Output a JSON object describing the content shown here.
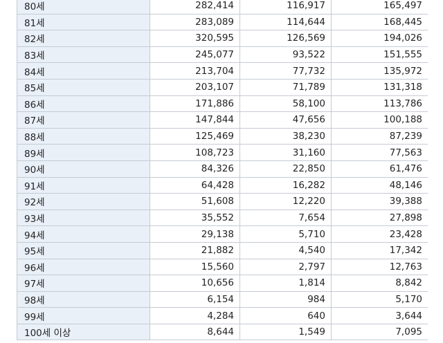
{
  "table": {
    "rows": [
      {
        "age": "80세",
        "total": "282,414",
        "male": "116,917",
        "female": "165,497"
      },
      {
        "age": "81세",
        "total": "283,089",
        "male": "114,644",
        "female": "168,445"
      },
      {
        "age": "82세",
        "total": "320,595",
        "male": "126,569",
        "female": "194,026"
      },
      {
        "age": "83세",
        "total": "245,077",
        "male": "93,522",
        "female": "151,555"
      },
      {
        "age": "84세",
        "total": "213,704",
        "male": "77,732",
        "female": "135,972"
      },
      {
        "age": "85세",
        "total": "203,107",
        "male": "71,789",
        "female": "131,318"
      },
      {
        "age": "86세",
        "total": "171,886",
        "male": "58,100",
        "female": "113,786"
      },
      {
        "age": "87세",
        "total": "147,844",
        "male": "47,656",
        "female": "100,188"
      },
      {
        "age": "88세",
        "total": "125,469",
        "male": "38,230",
        "female": "87,239"
      },
      {
        "age": "89세",
        "total": "108,723",
        "male": "31,160",
        "female": "77,563"
      },
      {
        "age": "90세",
        "total": "84,326",
        "male": "22,850",
        "female": "61,476"
      },
      {
        "age": "91세",
        "total": "64,428",
        "male": "16,282",
        "female": "48,146"
      },
      {
        "age": "92세",
        "total": "51,608",
        "male": "12,220",
        "female": "39,388"
      },
      {
        "age": "93세",
        "total": "35,552",
        "male": "7,654",
        "female": "27,898"
      },
      {
        "age": "94세",
        "total": "29,138",
        "male": "5,710",
        "female": "23,428"
      },
      {
        "age": "95세",
        "total": "21,882",
        "male": "4,540",
        "female": "17,342"
      },
      {
        "age": "96세",
        "total": "15,560",
        "male": "2,797",
        "female": "12,763"
      },
      {
        "age": "97세",
        "total": "10,656",
        "male": "1,814",
        "female": "8,842"
      },
      {
        "age": "98세",
        "total": "6,154",
        "male": "984",
        "female": "5,170"
      },
      {
        "age": "99세",
        "total": "4,284",
        "male": "640",
        "female": "3,644"
      },
      {
        "age": "100세 이상",
        "total": "8,644",
        "male": "1,549",
        "female": "7,095"
      }
    ]
  }
}
